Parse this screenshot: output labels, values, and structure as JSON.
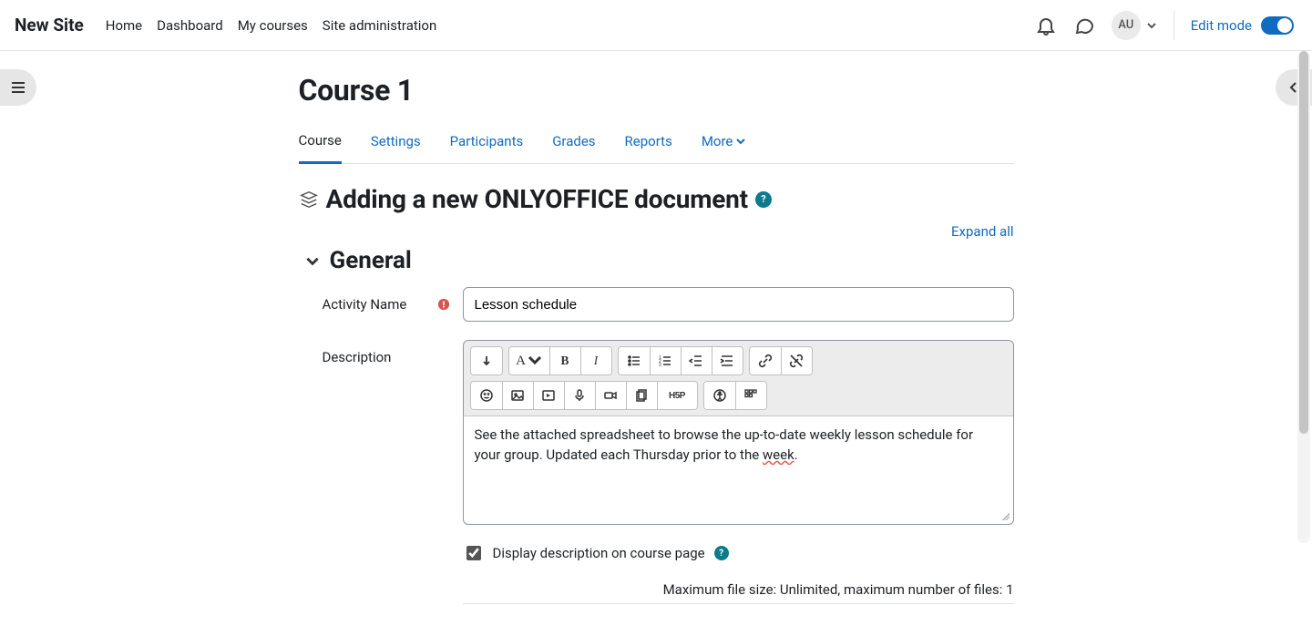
{
  "brand": "New Site",
  "nav": {
    "links": [
      "Home",
      "Dashboard",
      "My courses",
      "Site administration"
    ]
  },
  "user_initials": "AU",
  "edit_mode_label": "Edit mode",
  "course_title": "Course 1",
  "tabs": [
    {
      "label": "Course",
      "active": true
    },
    {
      "label": "Settings"
    },
    {
      "label": "Participants"
    },
    {
      "label": "Grades"
    },
    {
      "label": "Reports"
    },
    {
      "label": "More",
      "dropdown": true
    }
  ],
  "form_heading": "Adding a new ONLYOFFICE document",
  "expand_all": "Expand all",
  "section_general": "General",
  "fields": {
    "activity_name": {
      "label": "Activity Name",
      "value": "Lesson schedule"
    },
    "description": {
      "label": "Description",
      "value_prefix": "See the attached spreadsheet to browse the up-to-date weekly lesson schedule for your group. Updated each Thursday prior to the ",
      "value_spellerr": "week",
      "value_suffix": "."
    }
  },
  "display_desc_label": "Display description on course page",
  "file_hint": "Maximum file size: Unlimited, maximum number of files: 1",
  "help_glyph": "?"
}
